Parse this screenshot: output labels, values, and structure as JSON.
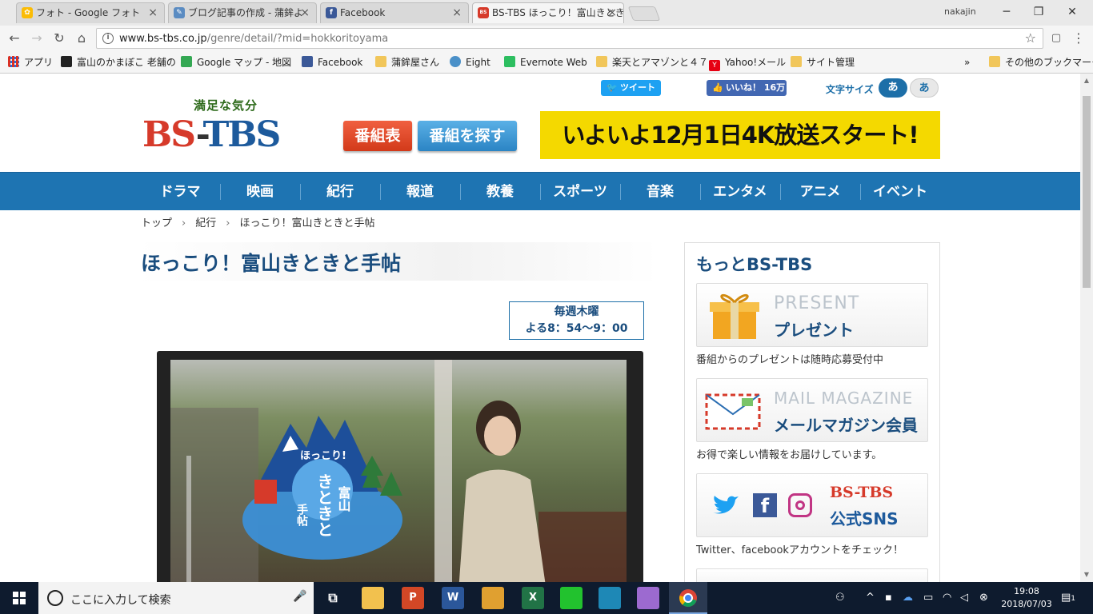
{
  "browser": {
    "tabs": [
      {
        "title": "フォト - Google フォト",
        "favicon_color": "#fbbc05"
      },
      {
        "title": "ブログ記事の作成 - 蒲鉾よ",
        "favicon_color": "#5b8cc2"
      },
      {
        "title": "Facebook",
        "favicon_color": "#3b5998"
      },
      {
        "title": "BS-TBS ほっこり！富山きときと手帖",
        "favicon_color": "#d63a2a"
      }
    ],
    "user_name": "nakajin",
    "url_host": "www.bs-tbs.co.jp",
    "url_path": "/genre/detail/?mid=hokkoritoyama",
    "bookmarks": [
      {
        "label": "アプリ",
        "icon": "apps-grid-icon"
      },
      {
        "label": "富山のかまぼこ 老舗の",
        "icon": "site-icon"
      },
      {
        "label": "Google マップ - 地図",
        "icon": "maps-icon"
      },
      {
        "label": "Facebook",
        "icon": "facebook-icon"
      },
      {
        "label": "蒲鉾屋さん",
        "icon": "folder-icon"
      },
      {
        "label": "Eight",
        "icon": "eight-icon"
      },
      {
        "label": "Evernote Web",
        "icon": "evernote-icon"
      },
      {
        "label": "楽天とアマゾンと４７",
        "icon": "folder-icon"
      },
      {
        "label": "Yahoo!メール",
        "icon": "yahoo-icon"
      },
      {
        "label": "サイト管理",
        "icon": "folder-icon"
      }
    ],
    "bookmarks_overflow": "»",
    "other_bookmarks": "その他のブックマーク"
  },
  "header": {
    "tweet_label": "ツイート",
    "like_label": "いいね！ 16万",
    "font_size_label": "文字サイズ",
    "font_small": "あ",
    "font_large": "あ",
    "logo_tagline": "満足な気分",
    "logo_bs": "BS",
    "logo_dash": "-",
    "logo_tbs": "TBS",
    "schedule_button": "番組表",
    "find_button": "番組を探す",
    "banner_text": "いよいよ12月1日4K放送スタート!"
  },
  "global_nav": [
    "ドラマ",
    "映画",
    "紀行",
    "報道",
    "教養",
    "スポーツ",
    "音楽",
    "エンタメ",
    "アニメ",
    "イベント"
  ],
  "breadcrumb": [
    "トップ",
    "紀行",
    "ほっこり！富山きときと手帖"
  ],
  "breadcrumb_sep": "›",
  "program": {
    "title": "ほっこり！富山きときと手帖",
    "air_day": "毎週木曜",
    "air_time": "よる8：54〜9：00",
    "logo_small_text": "ほっこり!",
    "logo_kitokito": "きときと",
    "logo_toyama": "富山",
    "logo_techo": "手帖"
  },
  "sidebar": {
    "title": "もっとBS-TBS",
    "present_en": "PRESENT",
    "present_ja": "プレゼント",
    "present_caption": "番組からのプレゼントは随時応募受付中",
    "mail_en": "MAIL MAGAZINE",
    "mail_ja": "メールマガジン会員",
    "mail_caption": "お得で楽しい情報をお届けしています。",
    "sns_brand": "BS-TBS",
    "sns_label": "公式SNS",
    "sns_caption": "Twitter、facebookアカウントをチェック！"
  },
  "taskbar": {
    "search_placeholder": "ここに入力して検索",
    "time": "19:08",
    "date": "2018/07/03",
    "notification_count": "1"
  },
  "colors": {
    "nav_blue": "#1e74b2",
    "title_navy": "#1a4d7e",
    "logo_red": "#d63a2a",
    "banner_yellow": "#f4d900"
  }
}
